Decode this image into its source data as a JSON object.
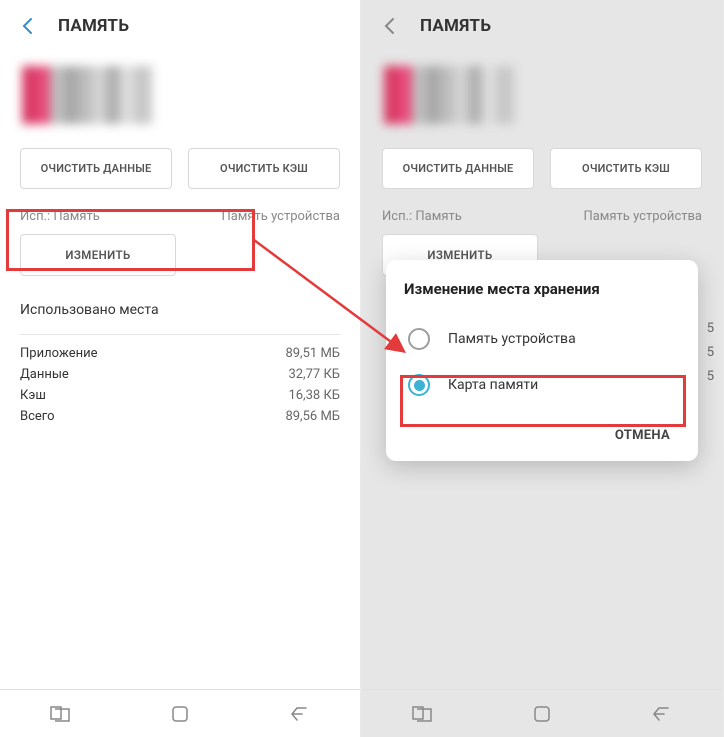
{
  "left": {
    "header_title": "ПАМЯТЬ",
    "clear_data_label": "ОЧИСТИТЬ ДАННЫЕ",
    "clear_cache_label": "ОЧИСТИТЬ КЭШ",
    "used_label": "Исп.: Память",
    "device_memory_label": "Память устройства",
    "change_label": "ИЗМЕНИТЬ",
    "used_space_label": "Использовано места",
    "rows": [
      {
        "label": "Приложение",
        "value": "89,51 МБ"
      },
      {
        "label": "Данные",
        "value": "32,77 КБ"
      },
      {
        "label": "Кэш",
        "value": "16,38 КБ"
      },
      {
        "label": "Всего",
        "value": "89,56 МБ"
      }
    ]
  },
  "right": {
    "header_title": "ПАМЯТЬ",
    "clear_data_label": "ОЧИСТИТЬ ДАННЫЕ",
    "clear_cache_label": "ОЧИСТИТЬ КЭШ",
    "used_label": "Исп.: Память",
    "device_memory_label": "Память устройства",
    "change_label": "ИЗМЕНИТЬ",
    "partial_values": [
      "5",
      "5",
      "5"
    ],
    "dialog": {
      "title": "Изменение места хранения",
      "option_device": "Память устройства",
      "option_card": "Карта памяти",
      "cancel": "ОТМЕНА"
    }
  },
  "colors": {
    "highlight": "#e33b3b",
    "accent": "#3ab3d4"
  }
}
